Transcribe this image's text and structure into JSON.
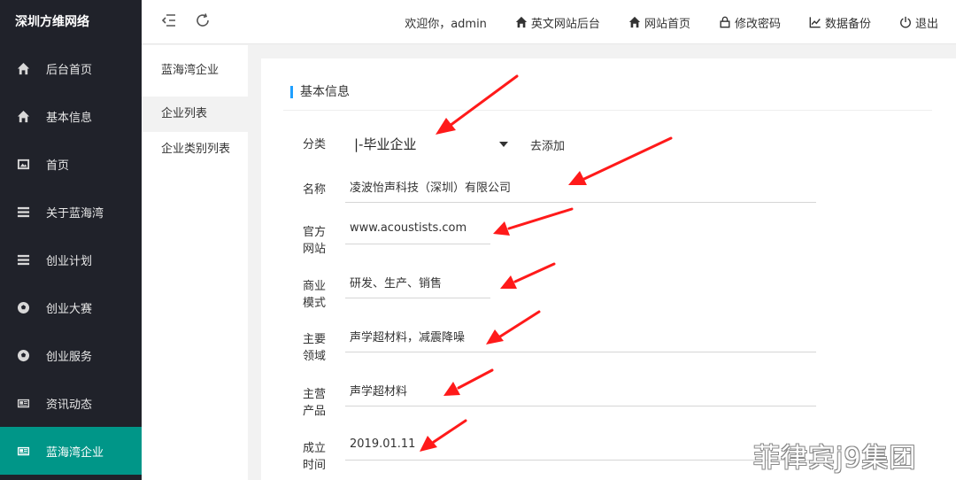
{
  "sidebar": {
    "brand": "深圳方维网络",
    "items": [
      {
        "label": "后台首页",
        "icon": "home-icon"
      },
      {
        "label": "基本信息",
        "icon": "home-icon"
      },
      {
        "label": "首页",
        "icon": "image-icon"
      },
      {
        "label": "关于蓝海湾",
        "icon": "menu-icon"
      },
      {
        "label": "创业计划",
        "icon": "menu-icon"
      },
      {
        "label": "创业大赛",
        "icon": "football-icon"
      },
      {
        "label": "创业服务",
        "icon": "football-icon"
      },
      {
        "label": "资讯动态",
        "icon": "newspaper-icon"
      },
      {
        "label": "蓝海湾企业",
        "icon": "newspaper-icon",
        "active": true
      }
    ],
    "active_color": "#009688"
  },
  "header": {
    "welcome": "欢迎你，admin",
    "links": [
      {
        "label": "英文网站后台",
        "icon": "home-icon"
      },
      {
        "label": "网站首页",
        "icon": "home-icon"
      },
      {
        "label": "修改密码",
        "icon": "lock-icon"
      },
      {
        "label": "数据备份",
        "icon": "chart-icon"
      },
      {
        "label": "退出",
        "icon": "power-icon"
      }
    ]
  },
  "subnav": {
    "title": "蓝海湾企业",
    "items": [
      "企业列表",
      "企业类别列表"
    ]
  },
  "form": {
    "section_title": "基本信息",
    "category_label": "分类",
    "category_value": "|-毕业企业",
    "add_link": "去添加",
    "name_label": "名称",
    "name_value": "凌波怡声科技（深圳）有限公司",
    "website_label_1": "官方",
    "website_label_2": "网站",
    "website_value": "www.acoustists.com",
    "business_label_1": "商业",
    "business_label_2": "模式",
    "business_value": "研发、生产、销售",
    "field_label_1": "主要",
    "field_label_2": "领域",
    "field_value": "声学超材料，减震降噪",
    "product_label_1": "主营",
    "product_label_2": "产品",
    "product_value": "声学超材料",
    "founded_label_1": "成立",
    "founded_label_2": "时间",
    "founded_value": "2019.01.11"
  },
  "watermark": "菲律宾j9集团",
  "colors": {
    "accent_blue": "#1e9fff",
    "arrow_red": "#ff1a1a",
    "sidebar_bg": "#20222a"
  }
}
